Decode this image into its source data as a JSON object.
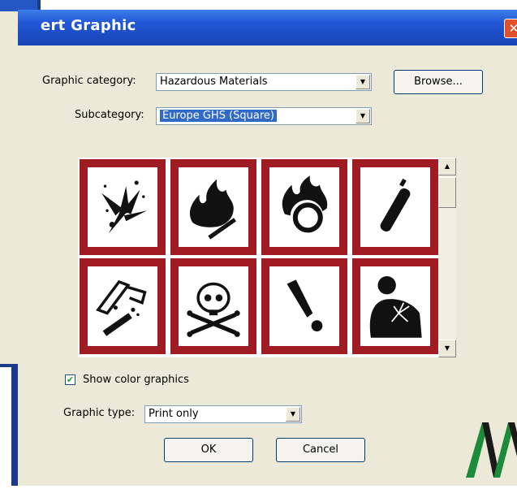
{
  "dialog": {
    "title": "ert Graphic",
    "close_glyph": "✕"
  },
  "category": {
    "label": "Graphic category:",
    "value": "Hazardous Materials"
  },
  "browse_button": "Browse...",
  "subcategory": {
    "label": "Subcategory:",
    "value": "Europe GHS (Square)"
  },
  "graphics": [
    {
      "name": "exploding-bomb-icon"
    },
    {
      "name": "flame-icon"
    },
    {
      "name": "flame-over-circle-icon"
    },
    {
      "name": "gas-cylinder-icon"
    },
    {
      "name": "corrosion-icon"
    },
    {
      "name": "skull-crossbones-icon"
    },
    {
      "name": "exclamation-icon"
    },
    {
      "name": "health-hazard-icon"
    }
  ],
  "show_color": {
    "label": "Show color graphics",
    "checked": true,
    "check_glyph": "✔"
  },
  "graphic_type": {
    "label": "Graphic type:",
    "value": "Print only"
  },
  "ok_button": "OK",
  "cancel_button": "Cancel",
  "scroll": {
    "up_glyph": "▲",
    "down_glyph": "▼"
  },
  "combo_arrow_glyph": "▼",
  "colors": {
    "titlebar": "#2358d6",
    "dialog_bg": "#ece9d8",
    "pictogram_border": "#a01c22",
    "selection": "#316ac5"
  }
}
